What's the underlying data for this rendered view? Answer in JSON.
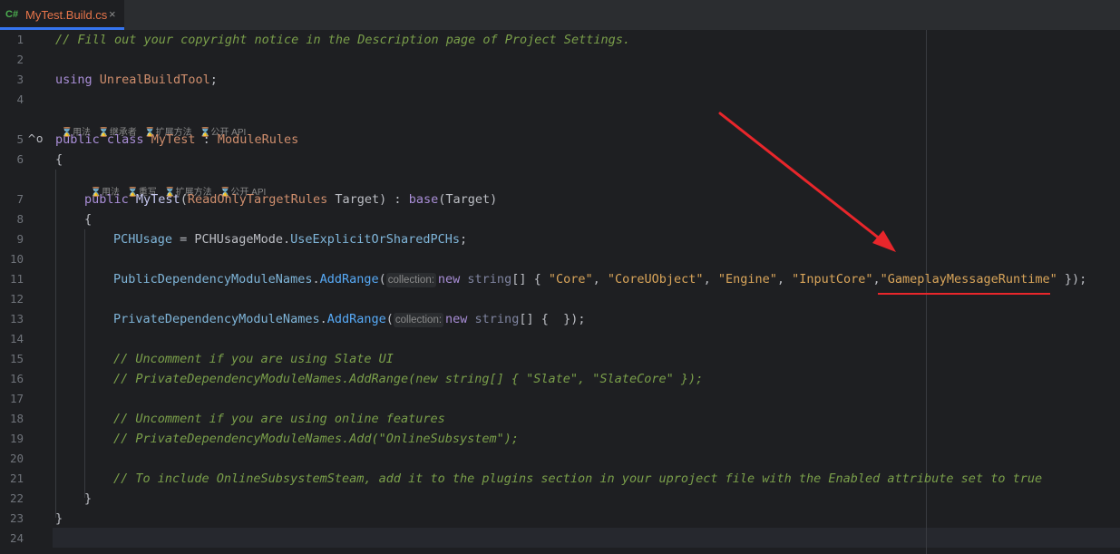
{
  "tab": {
    "lang_badge": "C#",
    "title": "MyTest.Build.cs",
    "close": "×"
  },
  "hints": {
    "class_hints": [
      "用法",
      "继承者",
      "扩展方法",
      "公开 API"
    ],
    "ctor_hints": [
      "用法",
      "重写",
      "扩展方法",
      "公开 API"
    ],
    "collection_param": "collection:"
  },
  "lines": [
    {
      "n": "1",
      "text": "// Fill out your copyright notice in the Description page of Project Settings."
    },
    {
      "n": "2",
      "text": ""
    },
    {
      "n": "3",
      "text": "using UnrealBuildTool;"
    },
    {
      "n": "4",
      "text": ""
    },
    {
      "n": "5",
      "text": "public class MyTest : ModuleRules"
    },
    {
      "n": "6",
      "text": "{"
    },
    {
      "n": "7",
      "text": "public MyTest(ReadOnlyTargetRules Target) : base(Target)"
    },
    {
      "n": "8",
      "text": "{"
    },
    {
      "n": "9",
      "text": "PCHUsage = PCHUsageMode.UseExplicitOrSharedPCHs;"
    },
    {
      "n": "10",
      "text": ""
    },
    {
      "n": "11",
      "text": "PublicDependencyModuleNames.AddRange(new string[] { \"Core\", \"CoreUObject\", \"Engine\", \"InputCore\",\"GameplayMessageRuntime\" });"
    },
    {
      "n": "12",
      "text": ""
    },
    {
      "n": "13",
      "text": "PrivateDependencyModuleNames.AddRange(new string[] {  });"
    },
    {
      "n": "14",
      "text": ""
    },
    {
      "n": "15",
      "text": "// Uncomment if you are using Slate UI"
    },
    {
      "n": "16",
      "text": "// PrivateDependencyModuleNames.AddRange(new string[] { \"Slate\", \"SlateCore\" });"
    },
    {
      "n": "17",
      "text": ""
    },
    {
      "n": "18",
      "text": "// Uncomment if you are using online features"
    },
    {
      "n": "19",
      "text": "// PrivateDependencyModuleNames.Add(\"OnlineSubsystem\");"
    },
    {
      "n": "20",
      "text": ""
    },
    {
      "n": "21",
      "text": "// To include OnlineSubsystemSteam, add it to the plugins section in your uproject file with the Enabled attribute set to true"
    },
    {
      "n": "22",
      "text": "}"
    },
    {
      "n": "23",
      "text": "}"
    },
    {
      "n": "24",
      "text": ""
    }
  ],
  "tokens": {
    "l1": "// Fill out your copyright notice in the Description page of Project Settings.",
    "l3_kw": "using",
    "l3_ns": "UnrealBuildTool",
    "l3_semi": ";",
    "l5_public": "public",
    "l5_class": "class",
    "l5_name": "MyTest",
    "l5_colon": " : ",
    "l5_base": "ModuleRules",
    "brace_open": "{",
    "brace_close": "}",
    "l7_public": "public",
    "l7_name": "MyTest",
    "l7_p1": "(",
    "l7_type": "ReadOnlyTargetRules",
    "l7_arg": " Target) : ",
    "l7_base": "base",
    "l7_p2": "(Target)",
    "l9_prop": "PCHUsage",
    "l9_eq": " = ",
    "l9_enum": "PCHUsageMode",
    "l9_dot": ".",
    "l9_val": "UseExplicitOrSharedPCHs",
    "l9_semi": ";",
    "l11_obj": "PublicDependencyModuleNames",
    "l11_dot": ".",
    "l11_m": "AddRange",
    "l11_p": "(",
    "kw_new": "new",
    "kw_string": " string",
    "l11_arr": "[] { ",
    "s_core": "\"Core\"",
    "comma_sp": ", ",
    "s_cuo": "\"CoreUObject\"",
    "s_engine": "\"Engine\"",
    "s_input": "\"InputCore\"",
    "comma": ",",
    "s_gmr": "\"GameplayMessageRuntime\"",
    "l11_end": " });",
    "l13_obj": "PrivateDependencyModuleNames",
    "l13_dot": ".",
    "l13_m": "AddRange",
    "l13_p": "(",
    "l13_arr": "[] {  });",
    "l15": "// Uncomment if you are using Slate UI",
    "l16": "// PrivateDependencyModuleNames.AddRange(new string[] { \"Slate\", \"SlateCore\" });",
    "l18": "// Uncomment if you are using online features",
    "l19": "// PrivateDependencyModuleNames.Add(\"OnlineSubsystem\");",
    "l21": "// To include OnlineSubsystemSteam, add it to the plugins section in your uproject file with the Enabled attribute set to true"
  },
  "annotation": {
    "color": "#e8262b"
  },
  "gutter_marks": {
    "line5": "^o"
  }
}
